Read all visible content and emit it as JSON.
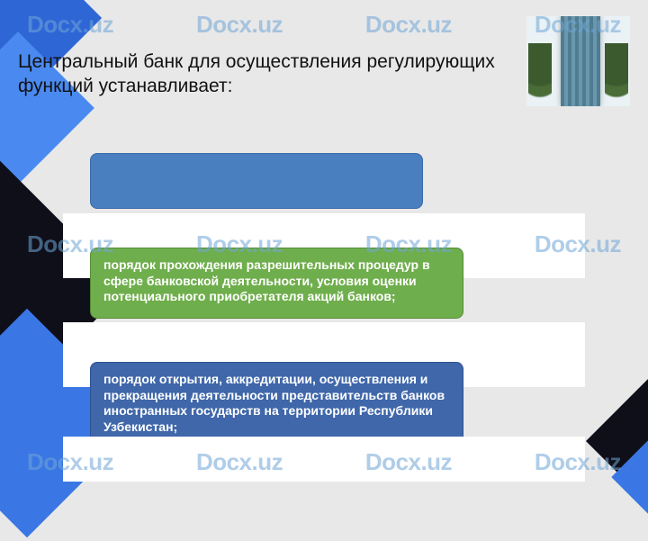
{
  "watermark": "Docx.uz",
  "heading": "Центральный банк для осуществления регулирующих функций устанавливает:",
  "cards": {
    "green": "порядок прохождения разрешительных процедур в сфере банковской деятельности, условия оценки потенциального приобретателя акций банков;",
    "darkblue": "порядок открытия, аккредитации, осуществления и прекращения деятельности представительств банков иностранных государств на территории Республики Узбекистан;"
  }
}
